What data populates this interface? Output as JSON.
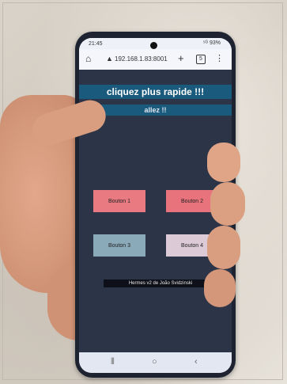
{
  "status": {
    "time": "21:45",
    "icons": "⁵ᴳ 93%"
  },
  "browser": {
    "url": "192.168.1.83:8001",
    "tab_count": "5"
  },
  "page": {
    "title": "cliquez plus rapide !!!",
    "subtitle": "allez !!",
    "buttons": [
      "Bouton 1",
      "Bouton 2",
      "Bouton 3",
      "Bouton 4"
    ],
    "footer": "Hermes v2 de João Svidzinski"
  },
  "colors": {
    "title_bg": "#1a5a7c",
    "button1": "#e97a82",
    "button2": "#e9737d",
    "button3": "#8aa9b9",
    "button4": "#dccad6"
  }
}
